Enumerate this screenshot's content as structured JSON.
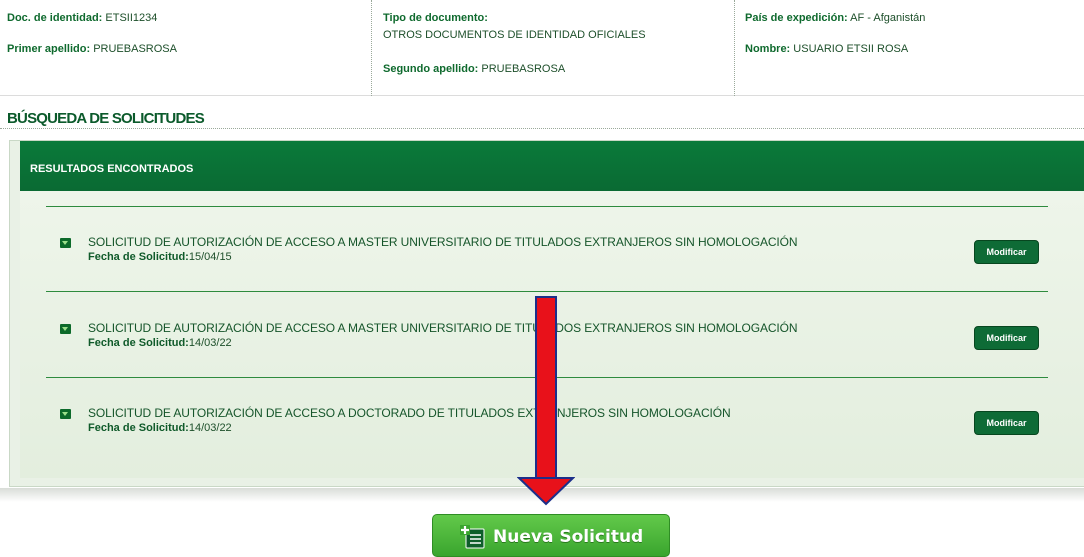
{
  "person": {
    "doc_id_label": "Doc. de identidad:",
    "doc_id_value": "ETSII1234",
    "first_surname_label": "Primer apellido:",
    "first_surname_value": "PRUEBASROSA",
    "doc_type_label": "Tipo de documento:",
    "doc_type_value": "OTROS DOCUMENTOS DE IDENTIDAD OFICIALES",
    "second_surname_label": "Segundo apellido:",
    "second_surname_value": "PRUEBASROSA",
    "country_label": "País de expedición:",
    "country_value": "AF - Afganistán",
    "name_label": "Nombre:",
    "name_value": "USUARIO ETSII ROSA"
  },
  "section_title": "BÚSQUEDA DE SOLICITUDES",
  "results": {
    "header": "RESULTADOS ENCONTRADOS",
    "date_label": "Fecha de Solicitud:",
    "modify_label": "Modificar",
    "items": [
      {
        "title": "SOLICITUD DE AUTORIZACIÓN DE ACCESO A MASTER UNIVERSITARIO DE TITULADOS EXTRANJEROS SIN HOMOLOGACIÓN",
        "date": "15/04/15"
      },
      {
        "title": "SOLICITUD DE AUTORIZACIÓN DE ACCESO A MASTER UNIVERSITARIO DE TITULADOS EXTRANJEROS SIN HOMOLOGACIÓN",
        "date": "14/03/22"
      },
      {
        "title": "SOLICITUD DE AUTORIZACIÓN DE ACCESO A DOCTORADO DE TITULADOS EXTRANJEROS SIN HOMOLOGACIÓN",
        "date": "14/03/22"
      }
    ]
  },
  "new_request_label": "Nueva Solicitud",
  "icons": {
    "row": "download-arrow-icon",
    "new": "add-document-icon",
    "annotation": "red-down-arrow-annotation"
  },
  "colors": {
    "primary_green": "#0a7a3a",
    "button_green": "#3aa52e",
    "annotation_red": "#e8111a"
  }
}
